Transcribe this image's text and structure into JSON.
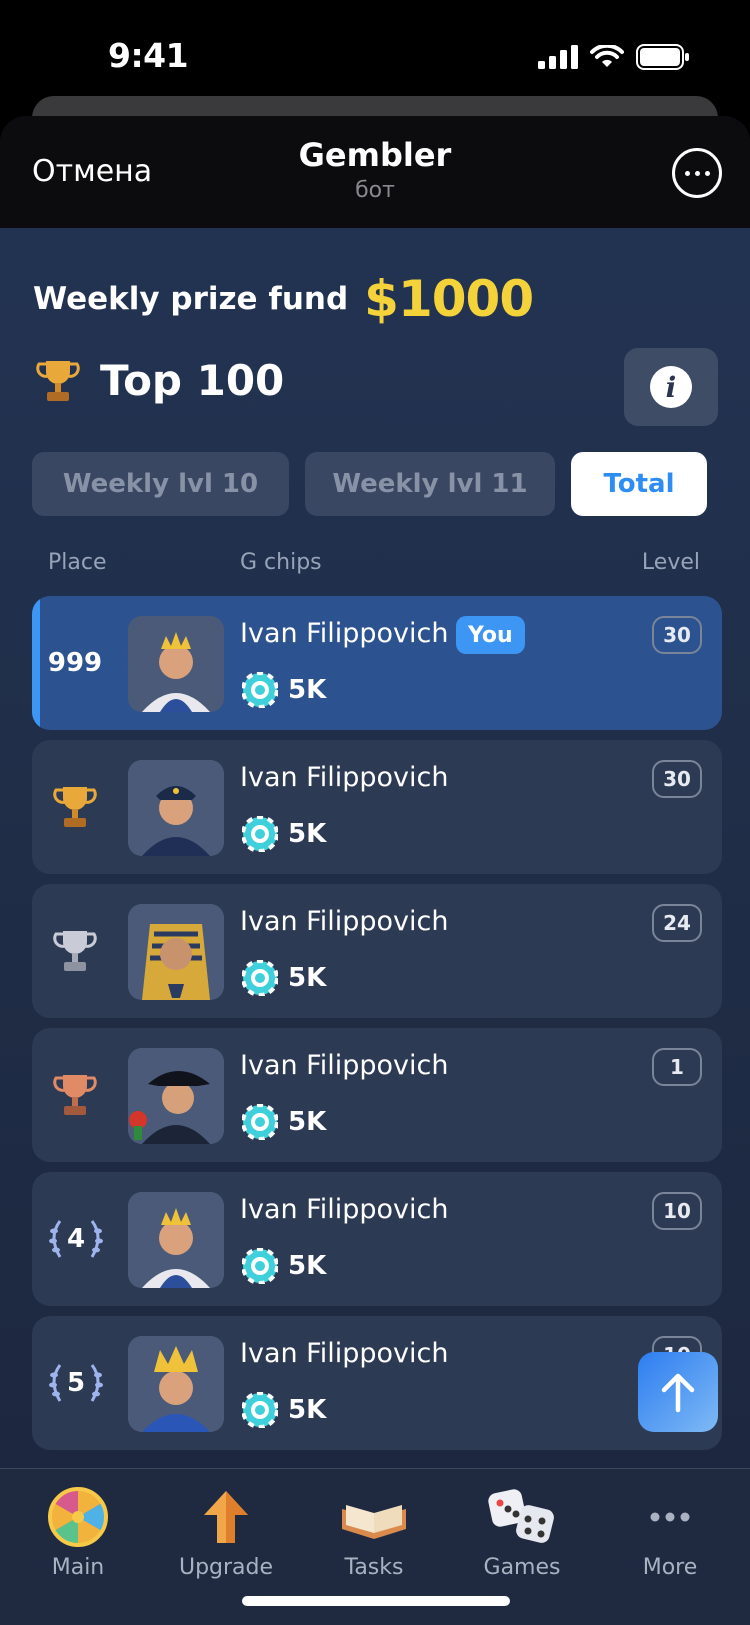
{
  "status": {
    "time": "9:41"
  },
  "header": {
    "cancel": "Отмена",
    "title": "Gembler",
    "subtitle": "бот"
  },
  "prize": {
    "label": "Weekly prize fund",
    "amount": "$1000"
  },
  "leaderboard": {
    "title": "Top 100",
    "tabs": [
      {
        "label": "Weekly lvl 10",
        "active": false
      },
      {
        "label": "Weekly lvl 11",
        "active": false
      },
      {
        "label": "Total",
        "active": true
      }
    ],
    "columns": {
      "place": "Place",
      "chips": "G chips",
      "level": "Level"
    },
    "rows": [
      {
        "place": "999",
        "name": "Ivan Filippovich",
        "badge": "You",
        "chips": "5K",
        "level": "30",
        "avatar": "king-avatar",
        "rank_icon": ""
      },
      {
        "place": "",
        "name": "Ivan Filippovich",
        "badge": "",
        "chips": "5K",
        "level": "30",
        "avatar": "police-avatar",
        "rank_icon": "gold-trophy"
      },
      {
        "place": "",
        "name": "Ivan Filippovich",
        "badge": "",
        "chips": "5K",
        "level": "24",
        "avatar": "pharaoh-avatar",
        "rank_icon": "silver-trophy"
      },
      {
        "place": "",
        "name": "Ivan Filippovich",
        "badge": "",
        "chips": "5K",
        "level": "1",
        "avatar": "pirate-avatar",
        "rank_icon": "bronze-trophy"
      },
      {
        "place": "4",
        "name": "Ivan Filippovich",
        "badge": "",
        "chips": "5K",
        "level": "10",
        "avatar": "king-avatar",
        "rank_icon": "laurel"
      },
      {
        "place": "5",
        "name": "Ivan Filippovich",
        "badge": "",
        "chips": "5K",
        "level": "10",
        "avatar": "crowned-man-avatar",
        "rank_icon": "laurel"
      }
    ]
  },
  "tabbar": [
    {
      "label": "Main",
      "icon": "wheel-icon"
    },
    {
      "label": "Upgrade",
      "icon": "arrow-up-icon"
    },
    {
      "label": "Tasks",
      "icon": "book-icon"
    },
    {
      "label": "Games",
      "icon": "dice-icon"
    },
    {
      "label": "More",
      "icon": "more-dots-icon"
    }
  ],
  "colors": {
    "accent": "#3D95F4",
    "prize": "#F4D33A",
    "background": "#223352",
    "row": "#2D3A54",
    "row_highlight": "#2C5290"
  }
}
